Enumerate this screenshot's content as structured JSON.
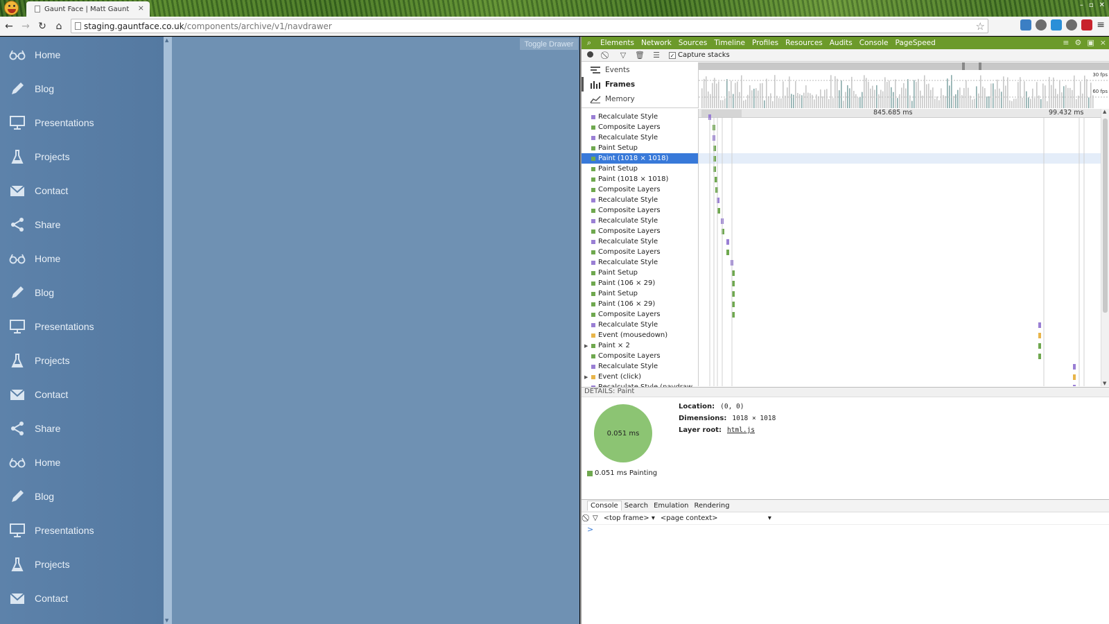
{
  "browser": {
    "tab_title": "Gaunt Face | Matt Gaunt",
    "url_host": "staging.gauntface.co.uk",
    "url_path": "/components/archive/v1/navdrawer"
  },
  "page": {
    "toggle_drawer_label": "Toggle Drawer",
    "drawer_items": [
      {
        "label": "Home",
        "icon": "glasses-icon"
      },
      {
        "label": "Blog",
        "icon": "pencil-icon"
      },
      {
        "label": "Presentations",
        "icon": "presentation-icon"
      },
      {
        "label": "Projects",
        "icon": "flask-icon"
      },
      {
        "label": "Contact",
        "icon": "mail-icon"
      },
      {
        "label": "Share",
        "icon": "share-icon"
      },
      {
        "label": "Home",
        "icon": "glasses-icon"
      },
      {
        "label": "Blog",
        "icon": "pencil-icon"
      },
      {
        "label": "Presentations",
        "icon": "presentation-icon"
      },
      {
        "label": "Projects",
        "icon": "flask-icon"
      },
      {
        "label": "Contact",
        "icon": "mail-icon"
      },
      {
        "label": "Share",
        "icon": "share-icon"
      },
      {
        "label": "Home",
        "icon": "glasses-icon"
      },
      {
        "label": "Blog",
        "icon": "pencil-icon"
      },
      {
        "label": "Presentations",
        "icon": "presentation-icon"
      },
      {
        "label": "Projects",
        "icon": "flask-icon"
      },
      {
        "label": "Contact",
        "icon": "mail-icon"
      }
    ]
  },
  "devtools": {
    "tabs": [
      "Elements",
      "Network",
      "Sources",
      "Timeline",
      "Profiles",
      "Resources",
      "Audits",
      "Console",
      "PageSpeed"
    ],
    "capture_stacks_label": "Capture stacks",
    "overview_items": [
      {
        "label": "Events",
        "active": false
      },
      {
        "label": "Frames",
        "active": true
      },
      {
        "label": "Memory",
        "active": false
      }
    ],
    "fps_30": "30 fps",
    "fps_60": "60 fps",
    "ruler_label_1": "845.685 ms",
    "ruler_label_2": "99.432 ms",
    "records": [
      {
        "label": "Recalculate Style",
        "color": "#9a7fd4"
      },
      {
        "label": "Composite Layers",
        "color": "#6fa84f"
      },
      {
        "label": "Recalculate Style",
        "color": "#9a7fd4"
      },
      {
        "label": "Paint Setup",
        "color": "#6fa84f"
      },
      {
        "label": "Paint (1018 × 1018)",
        "color": "#6fa84f",
        "selected": true
      },
      {
        "label": "Paint Setup",
        "color": "#6fa84f"
      },
      {
        "label": "Paint (1018 × 1018)",
        "color": "#6fa84f"
      },
      {
        "label": "Composite Layers",
        "color": "#6fa84f"
      },
      {
        "label": "Recalculate Style",
        "color": "#9a7fd4"
      },
      {
        "label": "Composite Layers",
        "color": "#6fa84f"
      },
      {
        "label": "Recalculate Style",
        "color": "#9a7fd4"
      },
      {
        "label": "Composite Layers",
        "color": "#6fa84f"
      },
      {
        "label": "Recalculate Style",
        "color": "#9a7fd4"
      },
      {
        "label": "Composite Layers",
        "color": "#6fa84f"
      },
      {
        "label": "Recalculate Style",
        "color": "#9a7fd4"
      },
      {
        "label": "Paint Setup",
        "color": "#6fa84f"
      },
      {
        "label": "Paint (106 × 29)",
        "color": "#6fa84f"
      },
      {
        "label": "Paint Setup",
        "color": "#6fa84f"
      },
      {
        "label": "Paint (106 × 29)",
        "color": "#6fa84f"
      },
      {
        "label": "Composite Layers",
        "color": "#6fa84f"
      },
      {
        "label": "Recalculate Style",
        "color": "#9a7fd4"
      },
      {
        "label": "Event (mousedown)",
        "color": "#e8b54a"
      },
      {
        "label": "Paint × 2",
        "color": "#6fa84f",
        "expandable": true
      },
      {
        "label": "Composite Layers",
        "color": "#6fa84f"
      },
      {
        "label": "Recalculate Style",
        "color": "#9a7fd4"
      },
      {
        "label": "Event (click)",
        "color": "#e8b54a",
        "expandable": true
      },
      {
        "label": "Recalculate Style",
        "color": "#9a7fd4",
        "link": "(navdraw..."
      }
    ],
    "details": {
      "header": "DETAILS: Paint",
      "pie_label": "0.051 ms",
      "legend": "0.051 ms Painting",
      "location_label": "Location:",
      "location_value": "(0, 0)",
      "dimensions_label": "Dimensions:",
      "dimensions_value": "1018 × 1018",
      "layer_root_label": "Layer root:",
      "layer_root_value": "html.js"
    },
    "drawer_tabs": [
      "Console",
      "Search",
      "Emulation",
      "Rendering"
    ],
    "frame_select": "<top frame>",
    "context_select": "<page context>",
    "prompt": ">"
  }
}
